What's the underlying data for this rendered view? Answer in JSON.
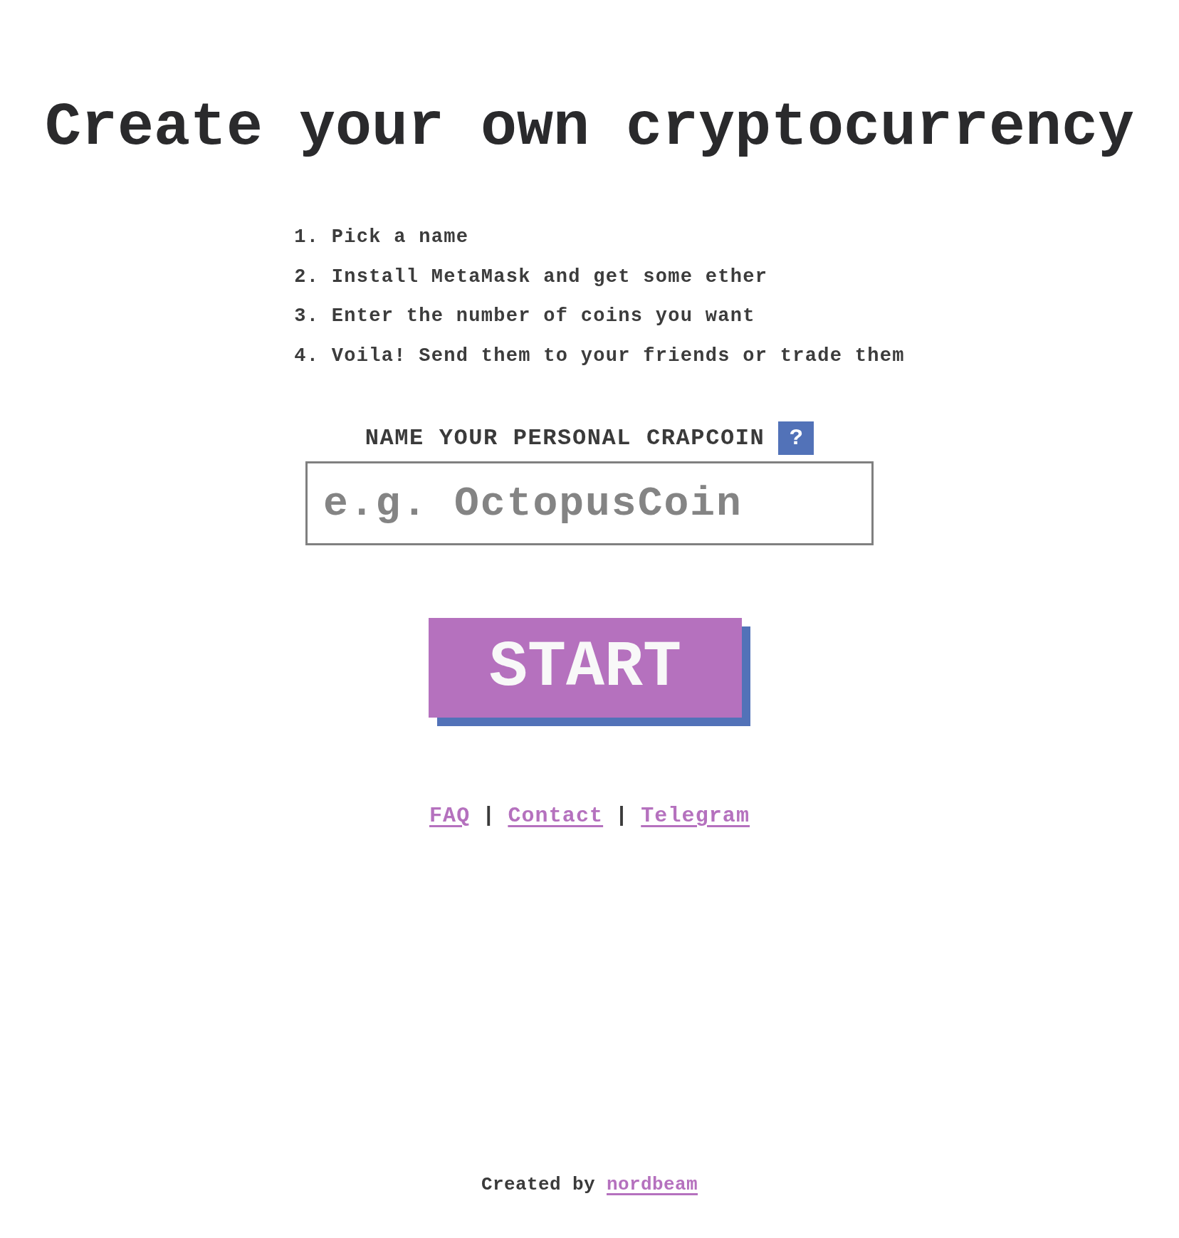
{
  "title": "Create your own cryptocurrency",
  "steps": [
    {
      "number": "1.",
      "text": "Pick a name"
    },
    {
      "number": "2.",
      "text": "Install MetaMask and get some ether"
    },
    {
      "number": "3.",
      "text": "Enter the number of coins you want"
    },
    {
      "number": "4.",
      "text": "Voila! Send them to your friends or trade them"
    }
  ],
  "name_field": {
    "label": "NAME YOUR PERSONAL CRAPCOIN",
    "help": "?",
    "placeholder": "e.g. OctopusCoin"
  },
  "start_button": {
    "label": "START"
  },
  "nav_links": [
    {
      "kind": "link",
      "text": "FAQ"
    },
    {
      "kind": "separator",
      "text": "|"
    },
    {
      "kind": "link",
      "text": "Contact"
    },
    {
      "kind": "separator",
      "text": "|"
    },
    {
      "kind": "link",
      "text": "Telegram"
    }
  ],
  "credit": {
    "text": "Created by",
    "link": "nordbeam"
  }
}
